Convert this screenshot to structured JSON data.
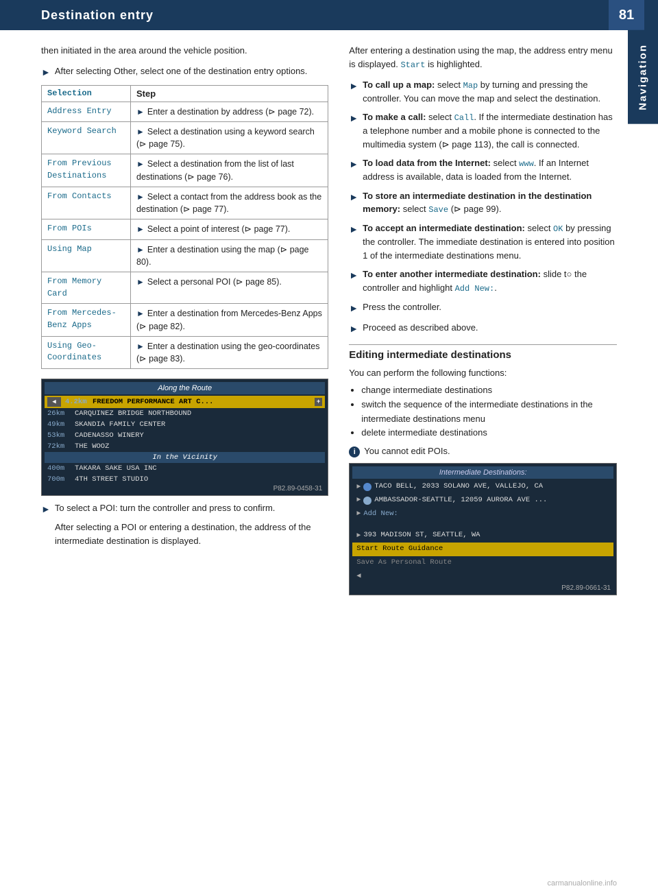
{
  "header": {
    "title": "Destination entry",
    "page_number": "81",
    "nav_label": "Navigation"
  },
  "left_col": {
    "intro_lines": [
      "then initiated in the area around the vehicle position.",
      "After selecting Other, select one of the destination entry options."
    ],
    "table": {
      "col1_header": "Selection",
      "col2_header": "Step",
      "rows": [
        {
          "selection": "Address Entry",
          "step": "Enter a destination by address (⊳ page 72)."
        },
        {
          "selection": "Keyword Search",
          "step": "Select a destination using a keyword search (⊳ page 75)."
        },
        {
          "selection": "From Previous Destinations",
          "step": "Select a destination from the list of last destinations (⊳ page 76)."
        },
        {
          "selection": "From Contacts",
          "step": "Select a contact from the address book as the destination (⊳ page 77)."
        },
        {
          "selection": "From POIs",
          "step": "Select a point of interest (⊳ page 77)."
        },
        {
          "selection": "Using Map",
          "step": "Enter a destination using the map (⊳ page 80)."
        },
        {
          "selection": "From Memory Card",
          "step": "Select a personal POI (⊳ page 85)."
        },
        {
          "selection": "From Mercedes-Benz Apps",
          "step": "Enter a destination from Mercedes-Benz Apps (⊳ page 82)."
        },
        {
          "selection": "Using Geo-Coordinates",
          "step": "Enter a destination using the geo-coordinates (⊳ page 83)."
        }
      ]
    },
    "screenshot1": {
      "header": "Along the Route",
      "rows": [
        {
          "type": "highlight",
          "dist": "4.2km",
          "text": "FREEDOM PERFORMANCE ART C...",
          "has_icon": true
        },
        {
          "type": "normal",
          "dist": "26km",
          "text": "CARQUINEZ BRIDGE NORTHBOUND"
        },
        {
          "type": "normal",
          "dist": "49km",
          "text": "SKANDIA FAMILY CENTER"
        },
        {
          "type": "normal",
          "dist": "53km",
          "text": "CADENASSO WINERY"
        },
        {
          "type": "normal",
          "dist": "72km",
          "text": "THE WOOZ"
        }
      ],
      "section2_header": "In the Vicinity",
      "rows2": [
        {
          "type": "normal",
          "dist": "400m",
          "text": "TAKARA SAKE USA INC"
        },
        {
          "type": "normal",
          "dist": "700m",
          "text": "4TH STREET STUDIO"
        }
      ],
      "caption": "P82.89-0458-31"
    },
    "after_screenshot_bullets": [
      "To select a POI: turn the controller and press to confirm.",
      "After selecting a POI or entering a destination, the address of the intermediate destination is displayed."
    ]
  },
  "right_col": {
    "intro": "After entering a destination using the map, the address entry menu is displayed. Start is highlighted.",
    "bullets": [
      {
        "label": "To call up a map:",
        "text": "select Map by turning and pressing the controller. You can move the map and select the destination."
      },
      {
        "label": "To make a call:",
        "text": "select Call. If the intermediate destination has a telephone number and a mobile phone is connected to the multimedia system (⊳ page 113), the call is connected."
      },
      {
        "label": "To load data from the Internet:",
        "text": "select www. If an Internet address is available, data is loaded from the Internet."
      },
      {
        "label": "To store an intermediate destination in the destination memory:",
        "text": "select Save (⊳ page 99)."
      },
      {
        "label": "To accept an intermediate destination:",
        "text": "select OK by pressing the controller. The immediate destination is entered into position 1 of the intermediate destinations menu."
      },
      {
        "label": "To enter another intermediate destination:",
        "text": "slide t○ the controller and highlight Add New:."
      },
      {
        "label": "Press the controller.",
        "text": ""
      },
      {
        "label": "Proceed as described above.",
        "text": ""
      }
    ],
    "section_heading": "Editing intermediate destinations",
    "section_intro": "You can perform the following functions:",
    "section_list": [
      "change intermediate destinations",
      "switch the sequence of the intermediate destinations in the intermediate destinations menu",
      "delete intermediate destinations"
    ],
    "info_note": "You cannot edit POIs.",
    "screenshot2": {
      "header": "Intermediate Destinations:",
      "rows": [
        {
          "type": "nav",
          "text": "TACO BELL, 2033 SOLANO AVE, VALLEJO, CA"
        },
        {
          "type": "phone",
          "text": "AMBASSADOR-SEATTLE, 12059 AURORA AVE ..."
        },
        {
          "type": "add",
          "text": "Add New:"
        },
        {
          "type": "empty",
          "text": ""
        },
        {
          "type": "normal",
          "text": "393 MADISON ST, SEATTLE, WA"
        },
        {
          "type": "highlight",
          "text": "Start Route Guidance"
        },
        {
          "type": "dimmed",
          "text": "Save As Personal Route"
        },
        {
          "type": "back",
          "text": "⇐"
        }
      ],
      "caption": "P82.89-0661-31"
    }
  },
  "watermark": "carmanualonline.info"
}
